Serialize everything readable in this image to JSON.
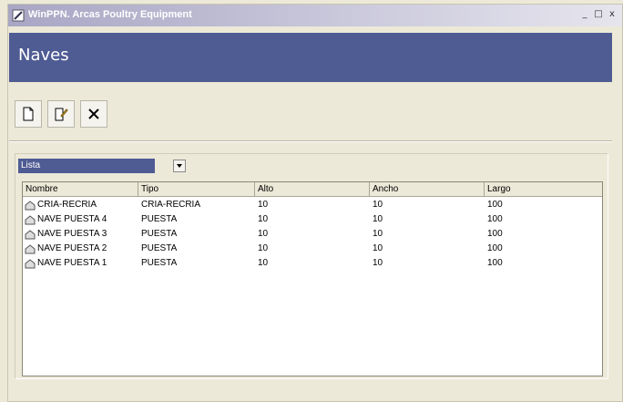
{
  "window": {
    "title": "WinPPN. Arcas Poultry Equipment",
    "controls": {
      "minimize": "_",
      "maximize": "□",
      "close": "x"
    }
  },
  "banner": {
    "title": "Naves"
  },
  "toolbar": {
    "icons": [
      "new-document-icon",
      "edit-icon",
      "delete-x-icon"
    ]
  },
  "filter": {
    "selected": "Lista"
  },
  "table": {
    "columns": [
      "Nombre",
      "Tipo",
      "Alto",
      "Ancho",
      "Largo"
    ],
    "rows": [
      {
        "nombre": "CRIA-RECRIA",
        "tipo": "CRIA-RECRIA",
        "alto": "10",
        "ancho": "10",
        "largo": "100"
      },
      {
        "nombre": "NAVE PUESTA 4",
        "tipo": "PUESTA",
        "alto": "10",
        "ancho": "10",
        "largo": "100"
      },
      {
        "nombre": "NAVE PUESTA 3",
        "tipo": "PUESTA",
        "alto": "10",
        "ancho": "10",
        "largo": "100"
      },
      {
        "nombre": "NAVE PUESTA 2",
        "tipo": "PUESTA",
        "alto": "10",
        "ancho": "10",
        "largo": "100"
      },
      {
        "nombre": "NAVE PUESTA 1",
        "tipo": "PUESTA",
        "alto": "10",
        "ancho": "10",
        "largo": "100"
      }
    ]
  },
  "colors": {
    "banner": "#4f5b93",
    "window_bg": "#ece9d8"
  }
}
